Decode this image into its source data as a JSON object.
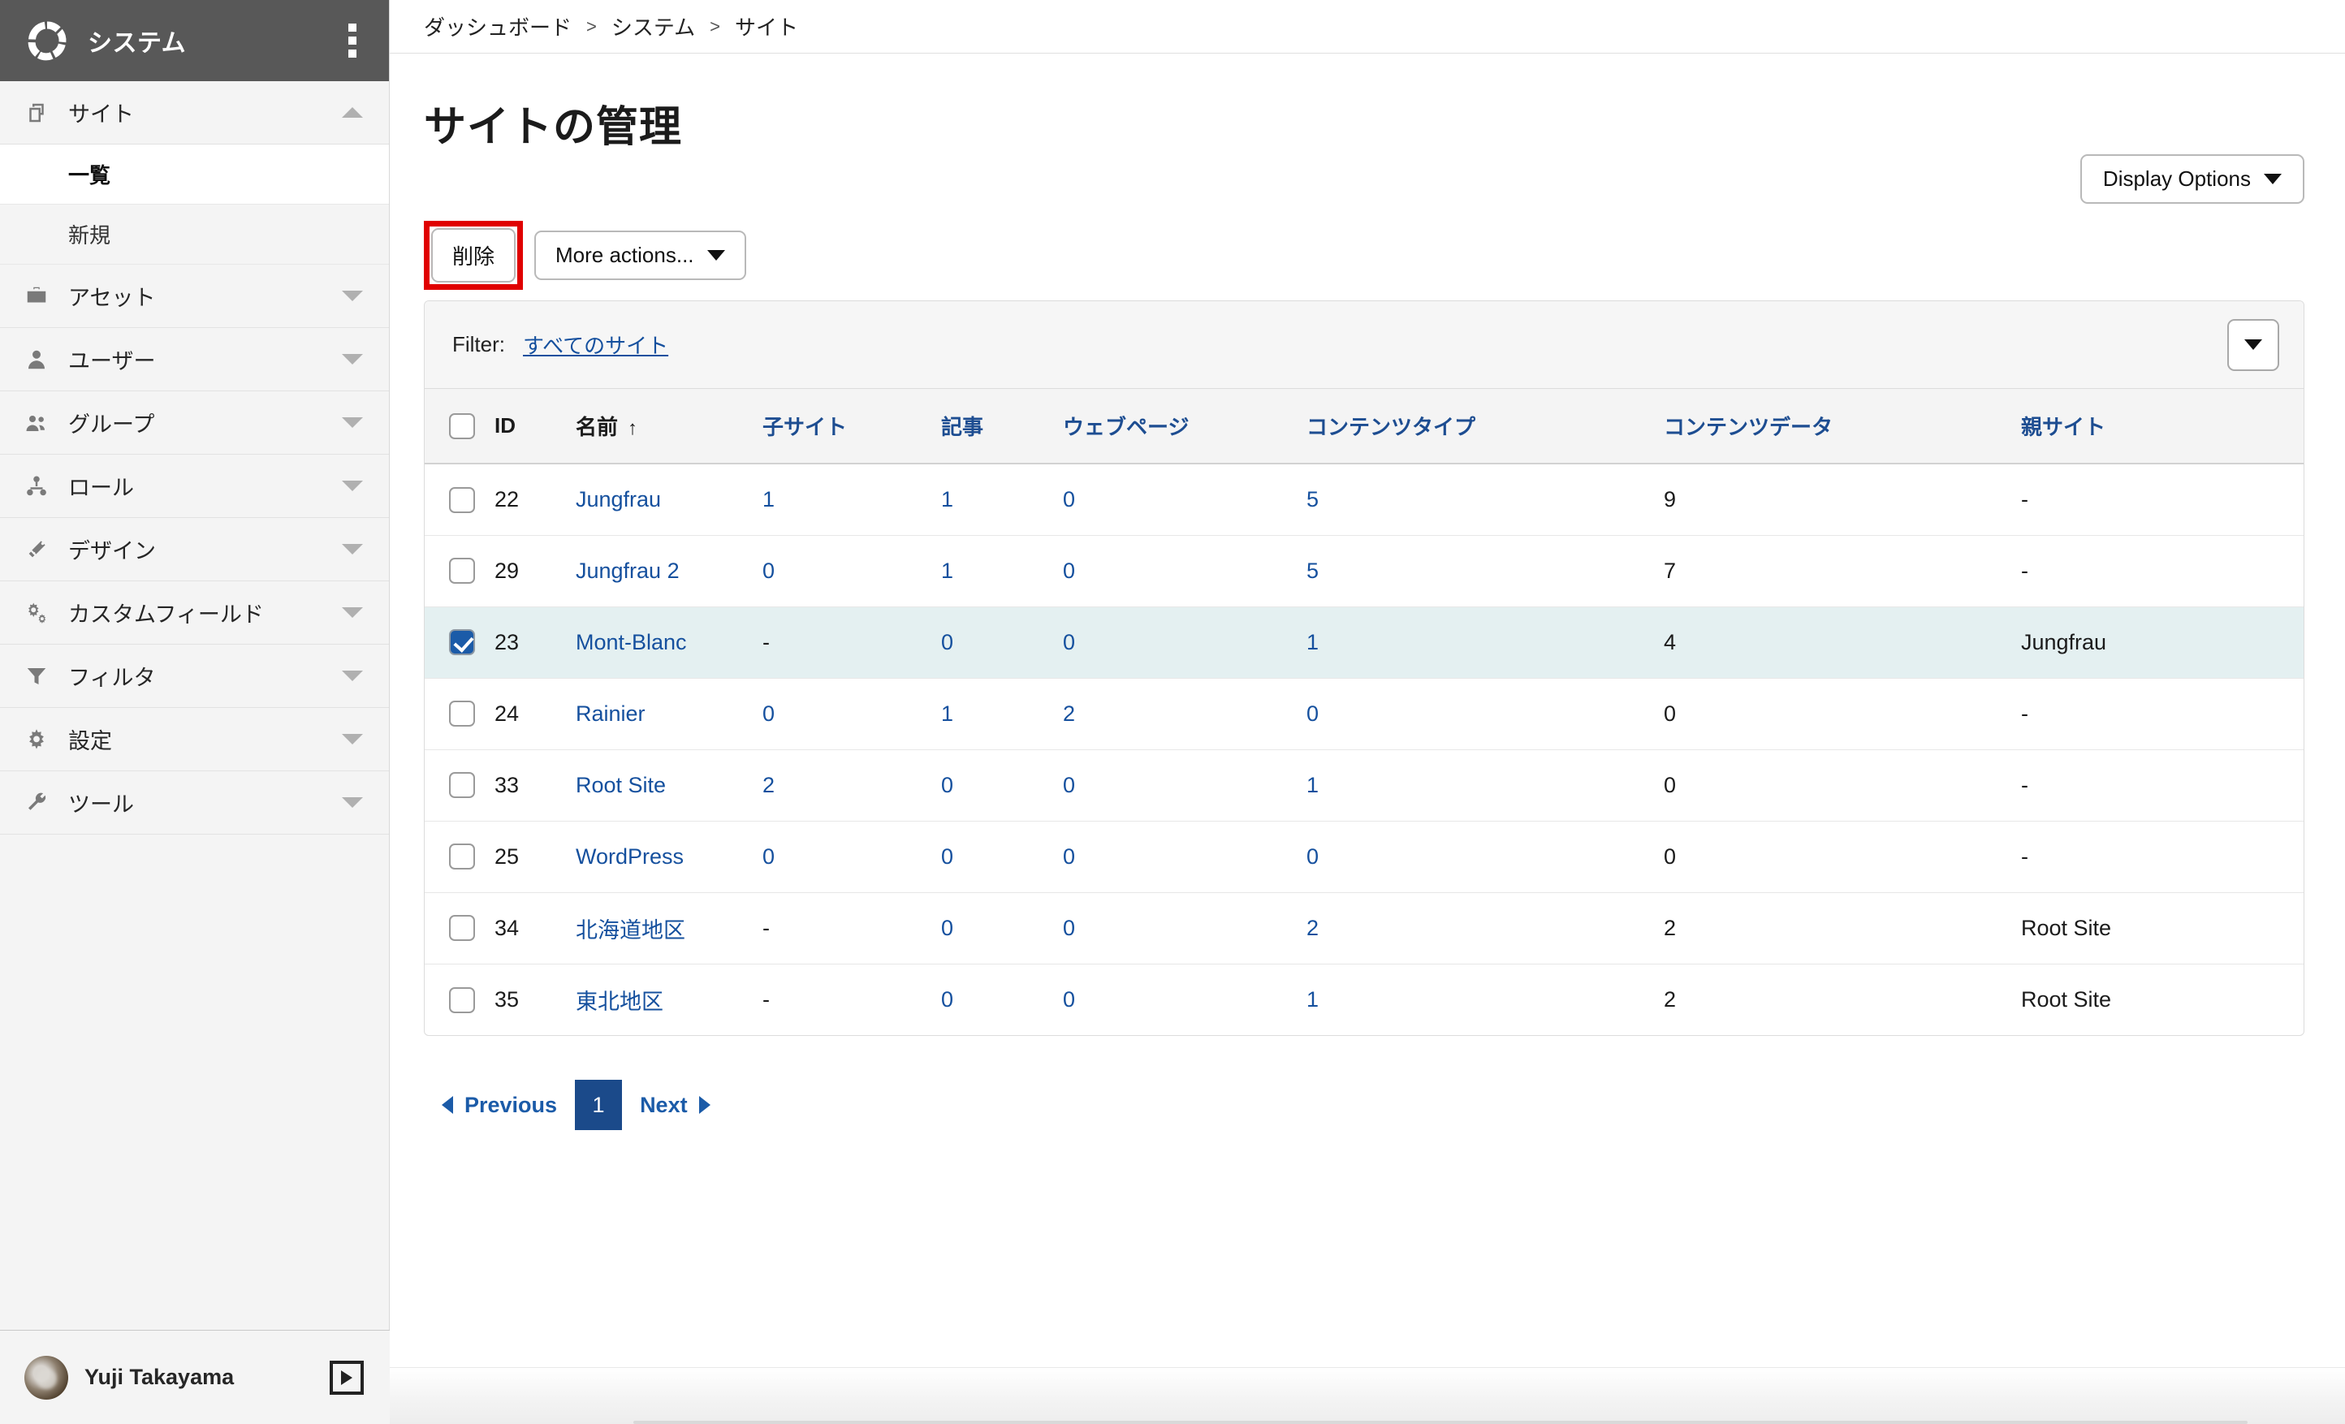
{
  "sidebar": {
    "brand": {
      "title": "システム",
      "logo_icon": "ring-logo-icon",
      "menu_icon": "kebab-menu-icon"
    },
    "items": [
      {
        "label": "サイト",
        "icon": "layers-icon",
        "caret": "up",
        "expanded": true
      },
      {
        "label": "アセット",
        "icon": "briefcase-icon",
        "caret": "down",
        "expanded": false
      },
      {
        "label": "ユーザー",
        "icon": "user-icon",
        "caret": "down",
        "expanded": false
      },
      {
        "label": "グループ",
        "icon": "users-icon",
        "caret": "down",
        "expanded": false
      },
      {
        "label": "ロール",
        "icon": "hierarchy-icon",
        "caret": "down",
        "expanded": false
      },
      {
        "label": "デザイン",
        "icon": "brush-icon",
        "caret": "down",
        "expanded": false
      },
      {
        "label": "カスタムフィールド",
        "icon": "gears-icon",
        "caret": "down",
        "expanded": false
      },
      {
        "label": "フィルタ",
        "icon": "funnel-icon",
        "caret": "down",
        "expanded": false
      },
      {
        "label": "設定",
        "icon": "gear-icon",
        "caret": "down",
        "expanded": false
      },
      {
        "label": "ツール",
        "icon": "wrench-icon",
        "caret": "down",
        "expanded": false
      }
    ],
    "subitems": [
      {
        "label": "一覧",
        "active": true
      },
      {
        "label": "新規",
        "active": false
      }
    ],
    "user": {
      "name": "Yuji Takayama",
      "expand_icon": "play-expand-icon"
    }
  },
  "breadcrumb": {
    "items": [
      "ダッシュボード",
      "システム",
      "サイト"
    ],
    "separator": ">"
  },
  "header": {
    "title": "サイトの管理"
  },
  "toolbar": {
    "delete_label": "削除",
    "more_actions_label": "More actions...",
    "display_options_label": "Display Options",
    "highlight_color": "#e00000"
  },
  "filter": {
    "label": "Filter:",
    "value": "すべてのサイト",
    "caret_icon": "chevron-down-icon"
  },
  "table": {
    "columns": [
      {
        "key": "check",
        "label": "",
        "style": "check"
      },
      {
        "key": "id",
        "label": "ID",
        "style": "plain"
      },
      {
        "key": "name",
        "label": "名前",
        "style": "plain",
        "sort": "↑"
      },
      {
        "key": "child",
        "label": "子サイト",
        "style": "link"
      },
      {
        "key": "art",
        "label": "記事",
        "style": "link"
      },
      {
        "key": "web",
        "label": "ウェブページ",
        "style": "link"
      },
      {
        "key": "ctype",
        "label": "コンテンツタイプ",
        "style": "link"
      },
      {
        "key": "cdata",
        "label": "コンテンツデータ",
        "style": "link"
      },
      {
        "key": "parent",
        "label": "親サイト",
        "style": "link"
      }
    ],
    "rows": [
      {
        "checked": false,
        "id": "22",
        "name": "Jungfrau",
        "child": "1",
        "art": "1",
        "web": "0",
        "ctype": "5",
        "cdata": "9",
        "parent": "-"
      },
      {
        "checked": false,
        "id": "29",
        "name": "Jungfrau 2",
        "child": "0",
        "art": "1",
        "web": "0",
        "ctype": "5",
        "cdata": "7",
        "parent": "-"
      },
      {
        "checked": true,
        "id": "23",
        "name": "Mont-Blanc",
        "child": "-",
        "art": "0",
        "web": "0",
        "ctype": "1",
        "cdata": "4",
        "parent": "Jungfrau"
      },
      {
        "checked": false,
        "id": "24",
        "name": "Rainier",
        "child": "0",
        "art": "1",
        "web": "2",
        "ctype": "0",
        "cdata": "0",
        "parent": "-"
      },
      {
        "checked": false,
        "id": "33",
        "name": "Root Site",
        "child": "2",
        "art": "0",
        "web": "0",
        "ctype": "1",
        "cdata": "0",
        "parent": "-"
      },
      {
        "checked": false,
        "id": "25",
        "name": "WordPress",
        "child": "0",
        "art": "0",
        "web": "0",
        "ctype": "0",
        "cdata": "0",
        "parent": "-"
      },
      {
        "checked": false,
        "id": "34",
        "name": "北海道地区",
        "child": "-",
        "art": "0",
        "web": "0",
        "ctype": "2",
        "cdata": "2",
        "parent": "Root Site"
      },
      {
        "checked": false,
        "id": "35",
        "name": "東北地区",
        "child": "-",
        "art": "0",
        "web": "0",
        "ctype": "1",
        "cdata": "2",
        "parent": "Root Site"
      }
    ]
  },
  "pagination": {
    "previous_label": "Previous",
    "next_label": "Next",
    "current_page": "1"
  },
  "colors": {
    "link": "#15509e",
    "accent": "#1b4a8a",
    "selected_row": "#e4f0f1",
    "sidebar_header": "#585858"
  }
}
